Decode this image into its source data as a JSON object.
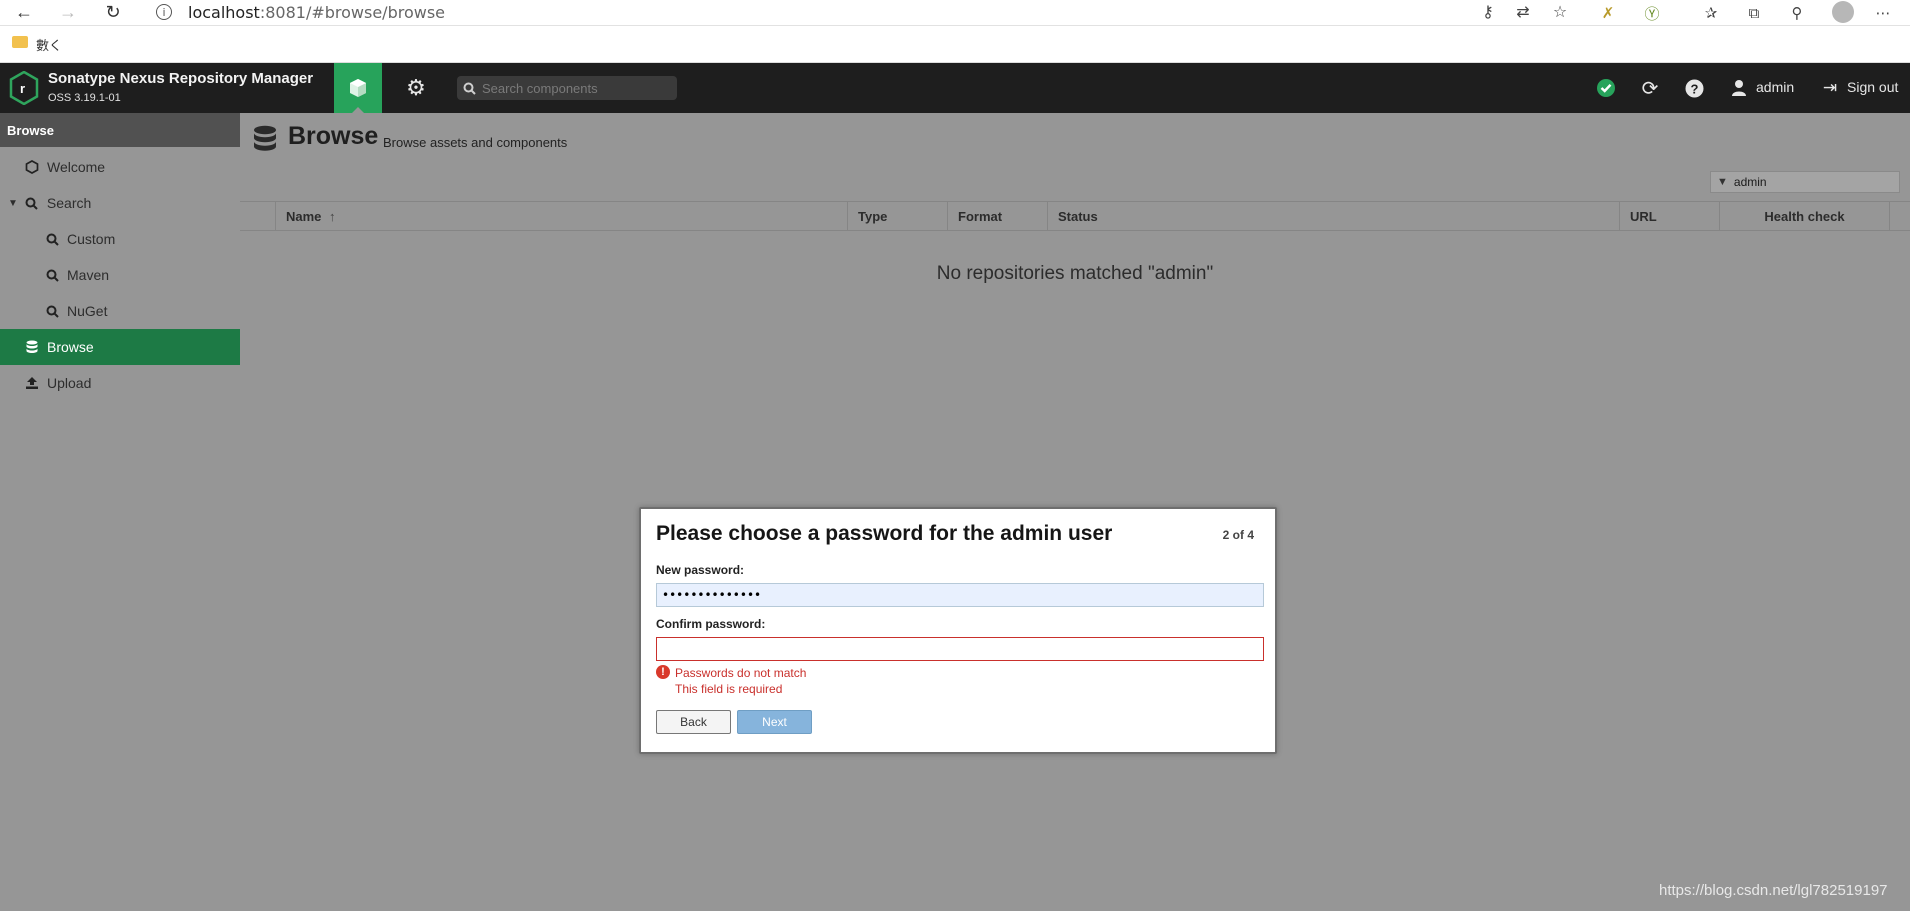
{
  "browser": {
    "url_host": "localhost",
    "url_port_path": ":8081/#browse/browse",
    "bookmark_label": "數く"
  },
  "header": {
    "title": "Sonatype Nexus Repository Manager",
    "version": "OSS 3.19.1-01",
    "search_placeholder": "Search components",
    "user_label": "admin",
    "signout_label": "Sign out"
  },
  "sidebar": {
    "heading": "Browse",
    "items": [
      {
        "label": "Welcome",
        "icon": "hexagon-icon"
      },
      {
        "label": "Search",
        "icon": "search-icon"
      },
      {
        "label": "Custom",
        "icon": "search-icon"
      },
      {
        "label": "Maven",
        "icon": "search-icon"
      },
      {
        "label": "NuGet",
        "icon": "search-icon"
      },
      {
        "label": "Browse",
        "icon": "database-icon"
      },
      {
        "label": "Upload",
        "icon": "upload-icon"
      }
    ]
  },
  "main": {
    "title": "Browse",
    "subtitle": "Browse assets and components",
    "filter_value": "admin",
    "columns": [
      "Name",
      "Type",
      "Format",
      "Status",
      "URL",
      "Health check"
    ],
    "empty_message": "No repositories matched \"admin\""
  },
  "dialog": {
    "title": "Please choose a password for the admin user",
    "step": "2 of 4",
    "new_password_label": "New password:",
    "new_password_value": "••••••••••••••",
    "confirm_password_label": "Confirm password:",
    "confirm_password_value": "",
    "errors": [
      "Passwords do not match",
      "This field is required"
    ],
    "back_label": "Back",
    "next_label": "Next"
  },
  "watermark": "https://blog.csdn.net/lgl782519197",
  "colors": {
    "accent_green": "#27a35b",
    "error_red": "#c9302c",
    "next_blue": "#86b4dc"
  }
}
